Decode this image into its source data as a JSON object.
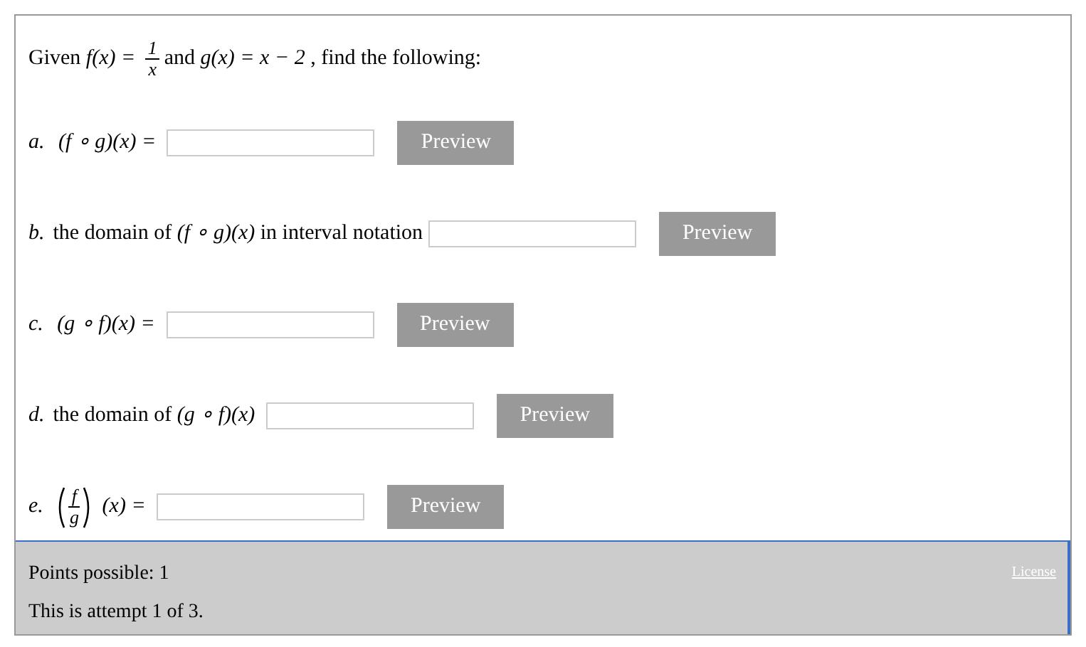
{
  "question": [
    {
      "kind": "text",
      "text": "Given "
    },
    {
      "kind": "math",
      "text": "f(x) ="
    },
    {
      "kind": "frac",
      "num": "1",
      "den": "x"
    },
    {
      "kind": "text",
      "text": " and "
    },
    {
      "kind": "math",
      "text": "g(x) = x − 2"
    },
    {
      "kind": "text",
      "text": ", find the following:"
    }
  ],
  "parts": [
    {
      "label": "a.",
      "prompt": [
        {
          "kind": "math",
          "text": "(f ∘ g)(x) ="
        }
      ],
      "button": "Preview"
    },
    {
      "label": "b.",
      "prompt": [
        {
          "kind": "text",
          "text": "the domain of "
        },
        {
          "kind": "math",
          "text": "(f ∘ g)(x)"
        },
        {
          "kind": "text",
          "text": " in interval notation"
        }
      ],
      "button": "Preview"
    },
    {
      "label": "c.",
      "prompt": [
        {
          "kind": "math",
          "text": "(g ∘ f)(x) ="
        }
      ],
      "button": "Preview"
    },
    {
      "label": "d.",
      "prompt": [
        {
          "kind": "text",
          "text": "the domain of "
        },
        {
          "kind": "math",
          "text": "(g ∘ f)(x)"
        }
      ],
      "button": "Preview"
    },
    {
      "label": "e.",
      "prompt": [
        {
          "kind": "pfrac",
          "num": "f",
          "den": "g"
        },
        {
          "kind": "math",
          "text": "(x) ="
        }
      ],
      "button": "Preview"
    }
  ],
  "footer": {
    "points": "Points possible: 1",
    "attempt": "This is attempt 1 of 3.",
    "license": "License"
  }
}
